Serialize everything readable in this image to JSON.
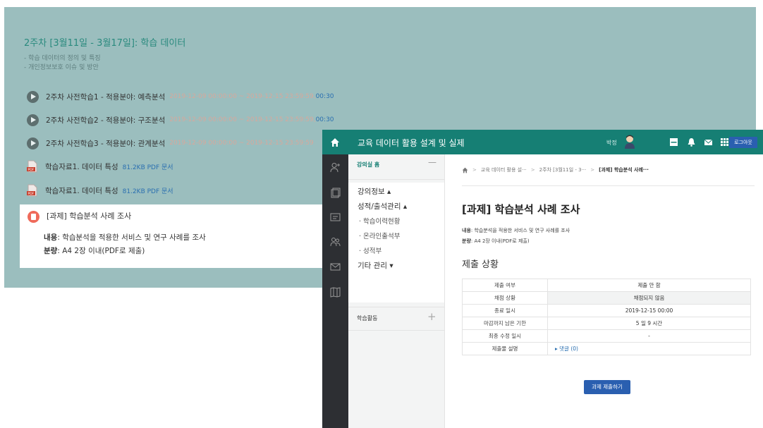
{
  "background_page": {
    "week_title": "2주차 [3월11일 - 3월17일]: 학습 데이터",
    "week_desc": [
      "- 학습 데이터의 정의 및 특징",
      "- 개인정보보호 이슈 및 방안"
    ],
    "resources": [
      {
        "title": "2주차 사전학습1 - 적용분야: 예측분석",
        "meta": "2019-12-09 00:00:00 ~ 2019-12-15 23:59:59,",
        "duration": "00:30",
        "icon": "play-icon"
      },
      {
        "title": "2주차 사전학습2 - 적용분야: 구조분석",
        "meta": "2019-12-09 00:00:00 ~ 2019-12-15 23:59:59,",
        "duration": "00:30",
        "icon": "play-icon"
      },
      {
        "title": "2주차 사전학습3 - 적용분야: 관계분석",
        "meta": "2019-12-09 00:00:00 ~ 2019-12-15 23:59:59",
        "duration": "",
        "icon": "play-icon"
      },
      {
        "title": "학습자료1. 데이터 특성",
        "size": "81.2KB PDF 문서",
        "icon": "pdf-icon"
      },
      {
        "title": "학습자료1. 데이터 특성",
        "size": "81.2KB PDF 문서",
        "icon": "pdf-icon"
      }
    ],
    "assignment": {
      "title": "[과제] 학습분석 사례 조사",
      "content_label": "내용",
      "content_text": ": 학습분석을 적용한 서비스 및 연구 사례를 조사",
      "amount_label": "분량",
      "amount_text": ": A4 2장 이내(PDF로 제출)"
    }
  },
  "window": {
    "course_title": "교육 데이터 활용 설계 및 실제",
    "user_name": "박정",
    "logout_label": "로그아웃",
    "nav": {
      "home_label": "강의실 홈",
      "collapse_symbol": "—",
      "items": {
        "course_info": "강의정보 ▴",
        "grades": "성적/출석관리 ▴",
        "learning_status": "· 학습이력현황",
        "online_attendance": "· 온라인출석부",
        "grade_book": "· 성적부",
        "other": "기타 관리 ▾"
      },
      "activities_label": "학습활동",
      "add_symbol": "+"
    },
    "breadcrumb": [
      "교육 데이터 활용 설···",
      "2주차 [3월11일 - 3···",
      "[과제] 학습분석 사례···"
    ],
    "page_title": "[과제] 학습분석 사례 조사",
    "content_label": "내용",
    "content_text": ": 학습분석을 적용한 서비스 및 연구 사례를 조사",
    "amount_label": "분량",
    "amount_text": ": A4 2장 이내(PDF로 제출)",
    "status_title": "제출 상황",
    "status_rows": [
      {
        "label": "제출 여부",
        "value": "제출 안 함"
      },
      {
        "label": "채점 상황",
        "value": "채점되지 않음"
      },
      {
        "label": "종료 일시",
        "value": "2019-12-15 00:00"
      },
      {
        "label": "마감까지 남은 기한",
        "value": "5 일 9 시간"
      },
      {
        "label": "최종 수정 일시",
        "value": "-"
      },
      {
        "label": "제출물 설명",
        "value": "▸ 댓글 (0)"
      }
    ],
    "submit_label": "과제 제출하기"
  },
  "colors": {
    "topbar": "#167f74",
    "overlay": "#9bbebe",
    "button_blue": "#2a5fb0",
    "icon_rail": "#2d2f33"
  }
}
